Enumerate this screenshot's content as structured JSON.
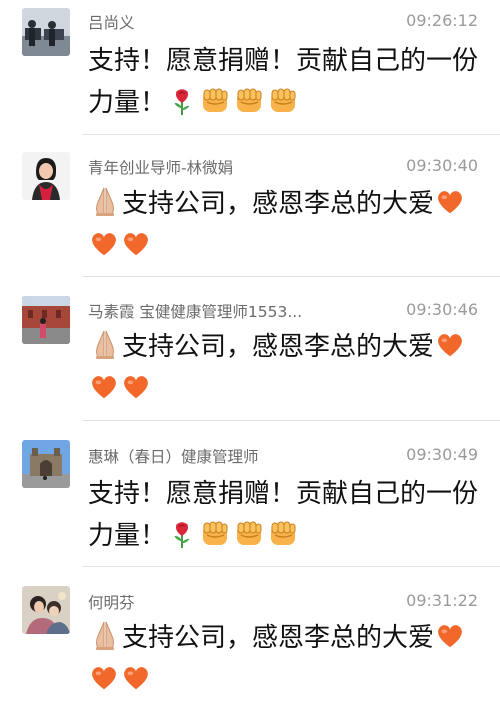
{
  "comments": [
    {
      "author": "吕尚义",
      "time": "09:26:12",
      "text_line1": "支持！愿意捐赠！贡献自己的一份",
      "text_line2": "力量！"
    },
    {
      "author": "青年创业导师-林微娟",
      "time": "09:30:40",
      "text": "支持公司，感恩李总的大爱"
    },
    {
      "author": "马素霞 宝健健康管理师1553...",
      "time": "09:30:46",
      "text": "支持公司，感恩李总的大爱"
    },
    {
      "author": "惠琳（春日）健康管理师",
      "time": "09:30:49",
      "text_line1": "支持！愿意捐赠！贡献自己的一份",
      "text_line2": "力量！"
    },
    {
      "author": "何明芬",
      "time": "09:31:22",
      "text": "支持公司，感恩李总的大爱"
    }
  ],
  "colors": {
    "heart": "#f2672a",
    "fist": "#f7b24a",
    "rose": "#d8263a",
    "hands": "#e9bfa0"
  }
}
